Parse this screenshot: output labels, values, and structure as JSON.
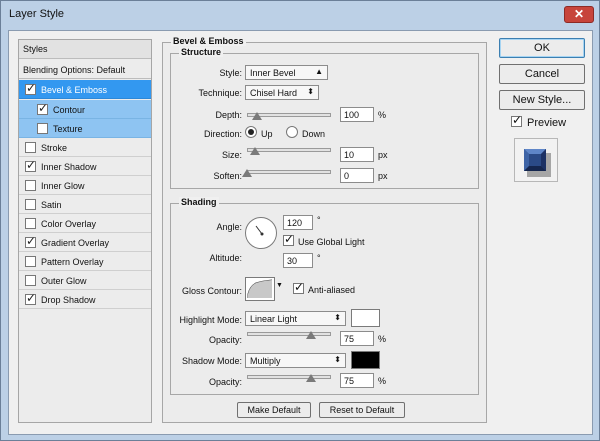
{
  "window": {
    "title": "Layer Style",
    "close_glyph": "✕"
  },
  "styles_panel": {
    "header": "Styles",
    "blending": "Blending Options: Default",
    "items": [
      {
        "label": "Bevel & Emboss",
        "checked": true
      },
      {
        "label": "Contour",
        "checked": true
      },
      {
        "label": "Texture",
        "checked": false
      },
      {
        "label": "Stroke",
        "checked": false
      },
      {
        "label": "Inner Shadow",
        "checked": true
      },
      {
        "label": "Inner Glow",
        "checked": false
      },
      {
        "label": "Satin",
        "checked": false
      },
      {
        "label": "Color Overlay",
        "checked": false
      },
      {
        "label": "Gradient Overlay",
        "checked": true
      },
      {
        "label": "Pattern Overlay",
        "checked": false
      },
      {
        "label": "Outer Glow",
        "checked": false
      },
      {
        "label": "Drop Shadow",
        "checked": true
      }
    ]
  },
  "bevel": {
    "title": "Bevel & Emboss",
    "structure": {
      "title": "Structure",
      "style_label": "Style:",
      "style_value": "Inner Bevel",
      "technique_label": "Technique:",
      "technique_value": "Chisel Hard",
      "depth_label": "Depth:",
      "depth_value": "100",
      "depth_unit": "%",
      "direction_label": "Direction:",
      "direction_up": "Up",
      "direction_down": "Down",
      "size_label": "Size:",
      "size_value": "10",
      "size_unit": "px",
      "soften_label": "Soften:",
      "soften_value": "0",
      "soften_unit": "px"
    },
    "shading": {
      "title": "Shading",
      "angle_label": "Angle:",
      "angle_value": "120",
      "angle_unit": "°",
      "global_light_label": "Use Global Light",
      "altitude_label": "Altitude:",
      "altitude_value": "30",
      "altitude_unit": "°",
      "gloss_label": "Gloss Contour:",
      "anti_aliased_label": "Anti-aliased",
      "highlight_mode_label": "Highlight Mode:",
      "highlight_mode_value": "Linear Light",
      "highlight_color": "#ffffff",
      "opacity_label": "Opacity:",
      "highlight_opacity": "75",
      "shadow_mode_label": "Shadow Mode:",
      "shadow_mode_value": "Multiply",
      "shadow_color": "#000000",
      "shadow_opacity": "75",
      "percent": "%"
    },
    "make_default": "Make Default",
    "reset_default": "Reset to Default"
  },
  "buttons": {
    "ok": "OK",
    "cancel": "Cancel",
    "new_style": "New Style...",
    "preview": "Preview"
  },
  "colors": {
    "selection": "#3398f0",
    "subselection": "#8ec4f2",
    "accent_border": "#3c7fb1"
  }
}
